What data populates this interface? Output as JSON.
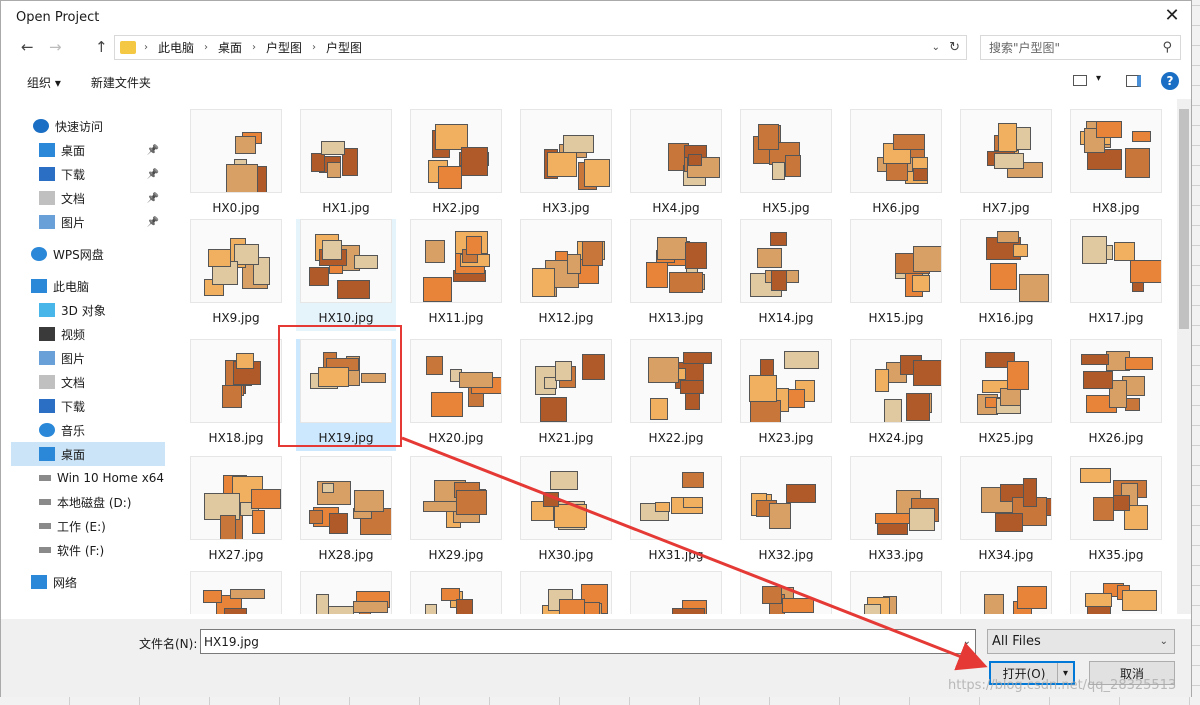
{
  "window": {
    "title": "Open Project",
    "close_label": "✕"
  },
  "nav": {
    "back": "←",
    "forward": "→",
    "up": "↑"
  },
  "address": {
    "crumbs": [
      "此电脑",
      "桌面",
      "户型图",
      "户型图"
    ]
  },
  "search": {
    "placeholder": "搜索\"户型图\""
  },
  "toolbar": {
    "organize": "组织 ▾",
    "new_folder": "新建文件夹"
  },
  "sidebar": {
    "items": [
      {
        "label": "快速访问",
        "icon": "star-icon",
        "pinned": false
      },
      {
        "label": "桌面",
        "icon": "desktop-icon",
        "pinned": true
      },
      {
        "label": "下载",
        "icon": "download-icon",
        "pinned": true
      },
      {
        "label": "文档",
        "icon": "document-icon",
        "pinned": true
      },
      {
        "label": "图片",
        "icon": "picture-icon",
        "pinned": true
      },
      {
        "label": "WPS网盘",
        "icon": "cloud-icon",
        "pinned": false
      },
      {
        "label": "此电脑",
        "icon": "computer-icon",
        "pinned": false
      },
      {
        "label": "3D 对象",
        "icon": "cube-icon",
        "pinned": false
      },
      {
        "label": "视频",
        "icon": "video-icon",
        "pinned": false
      },
      {
        "label": "图片",
        "icon": "picture-icon",
        "pinned": false
      },
      {
        "label": "文档",
        "icon": "document-icon",
        "pinned": false
      },
      {
        "label": "下载",
        "icon": "download-icon",
        "pinned": false
      },
      {
        "label": "音乐",
        "icon": "music-icon",
        "pinned": false
      },
      {
        "label": "桌面",
        "icon": "desktop-icon",
        "pinned": false
      },
      {
        "label": "Win 10 Home x64",
        "icon": "drive-icon",
        "pinned": false
      },
      {
        "label": "本地磁盘 (D:)",
        "icon": "drive-icon",
        "pinned": false
      },
      {
        "label": "工作 (E:)",
        "icon": "drive-icon",
        "pinned": false
      },
      {
        "label": "软件 (F:)",
        "icon": "drive-icon",
        "pinned": false
      },
      {
        "label": "网络",
        "icon": "network-icon",
        "pinned": false
      }
    ]
  },
  "files": [
    "HX0.jpg",
    "HX1.jpg",
    "HX2.jpg",
    "HX3.jpg",
    "HX4.jpg",
    "HX5.jpg",
    "HX6.jpg",
    "HX7.jpg",
    "HX8.jpg",
    "HX9.jpg",
    "HX10.jpg",
    "HX11.jpg",
    "HX12.jpg",
    "HX13.jpg",
    "HX14.jpg",
    "HX15.jpg",
    "HX16.jpg",
    "HX17.jpg",
    "HX18.jpg",
    "HX19.jpg",
    "HX20.jpg",
    "HX21.jpg",
    "HX22.jpg",
    "HX23.jpg",
    "HX24.jpg",
    "HX25.jpg",
    "HX26.jpg",
    "HX27.jpg",
    "HX28.jpg",
    "HX29.jpg",
    "HX30.jpg",
    "HX31.jpg",
    "HX32.jpg",
    "HX33.jpg",
    "HX34.jpg",
    "HX35.jpg",
    "",
    "",
    "",
    "",
    "",
    "",
    "",
    "",
    ""
  ],
  "selected_file": "HX19.jpg",
  "hover_file": "HX10.jpg",
  "bottom": {
    "filename_label": "文件名(N):",
    "filename_value": "HX19.jpg",
    "filetype_value": "All Files",
    "open_label": "打开(O)",
    "cancel_label": "取消"
  },
  "watermark": "https://blog.csdn.net/qq_28325513",
  "colors": {
    "selection": "#cce8ff",
    "accent": "#0078d7",
    "annotation": "#e53935"
  }
}
